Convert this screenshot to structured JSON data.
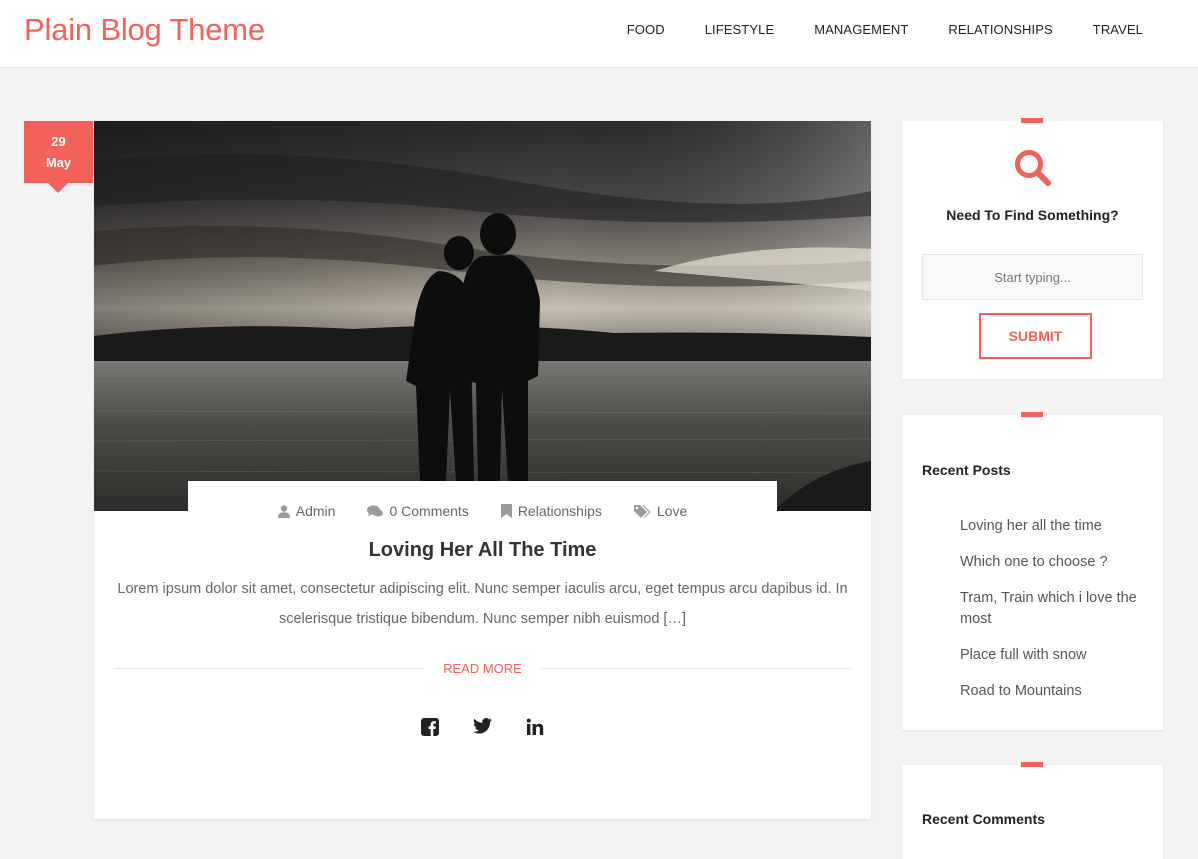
{
  "header": {
    "site_title": "Plain Blog Theme",
    "nav": [
      "FOOD",
      "LIFESTYLE",
      "MANAGEMENT",
      "RELATIONSHIPS",
      "TRAVEL"
    ]
  },
  "post": {
    "date_day": "29",
    "date_month": "May",
    "meta": {
      "author": "Admin",
      "comments": "0 Comments",
      "category": "Relationships",
      "tag": "Love"
    },
    "title": "Loving Her All The Time",
    "excerpt": "Lorem ipsum dolor sit amet, consectetur adipiscing elit. Nunc semper iaculis arcu, eget tempus arcu dapibus id. In scelerisque tristique bibendum. Nunc semper nibh euismod […]",
    "read_more": "READ MORE",
    "social_icons": [
      "facebook-icon",
      "twitter-icon",
      "linkedin-icon"
    ]
  },
  "sidebar": {
    "search": {
      "heading": "Need To Find Something?",
      "placeholder": "Start typing...",
      "submit": "SUBMIT"
    },
    "recent_posts": {
      "title": "Recent Posts",
      "items": [
        "Loving her all the time",
        "Which one to choose ?",
        "Tram, Train which i love the most",
        "Place full with snow",
        "Road to Mountains"
      ]
    },
    "recent_comments": {
      "title": "Recent Comments"
    }
  },
  "colors": {
    "accent": "#f4615a",
    "background": "#f3f3f3"
  }
}
